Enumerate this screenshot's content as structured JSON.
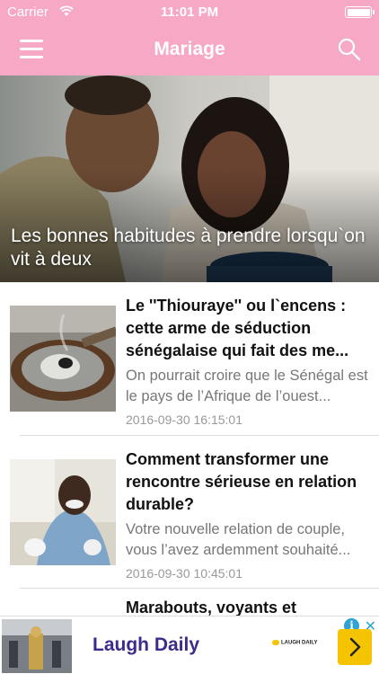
{
  "status": {
    "carrier": "Carrier",
    "time": "11:01 PM"
  },
  "nav": {
    "title": "Mariage"
  },
  "hero": {
    "title": "Les bonnes habitudes à prendre lorsqu`on vit à deux"
  },
  "articles": [
    {
      "title": "Le ''Thiouraye'' ou l`encens : cette arme de séduction sénégalaise qui fait des me...",
      "excerpt": "On pourrait croire que le Sénégal est le pays de l’Afrique de l’ouest...",
      "date": "2016-09-30 16:15:01"
    },
    {
      "title": "Comment transformer une rencontre sérieuse en relation durable?",
      "excerpt": "Votre nouvelle relation de couple, vous l’avez ardemment souhaité...",
      "date": "2016-09-30 10:45:01"
    },
    {
      "title": "Marabouts, voyants et"
    }
  ],
  "ad": {
    "name": "Laugh Daily",
    "logo_text": "LAUGH DAILY",
    "info": "i",
    "close": "✕"
  },
  "colors": {
    "brand": "#f7a8c5",
    "ad_accent": "#f5c400",
    "ad_text": "#3d2a8a"
  },
  "icons": {
    "menu": "hamburger-icon",
    "search": "search-icon",
    "wifi": "wifi-icon",
    "battery": "battery-icon"
  }
}
